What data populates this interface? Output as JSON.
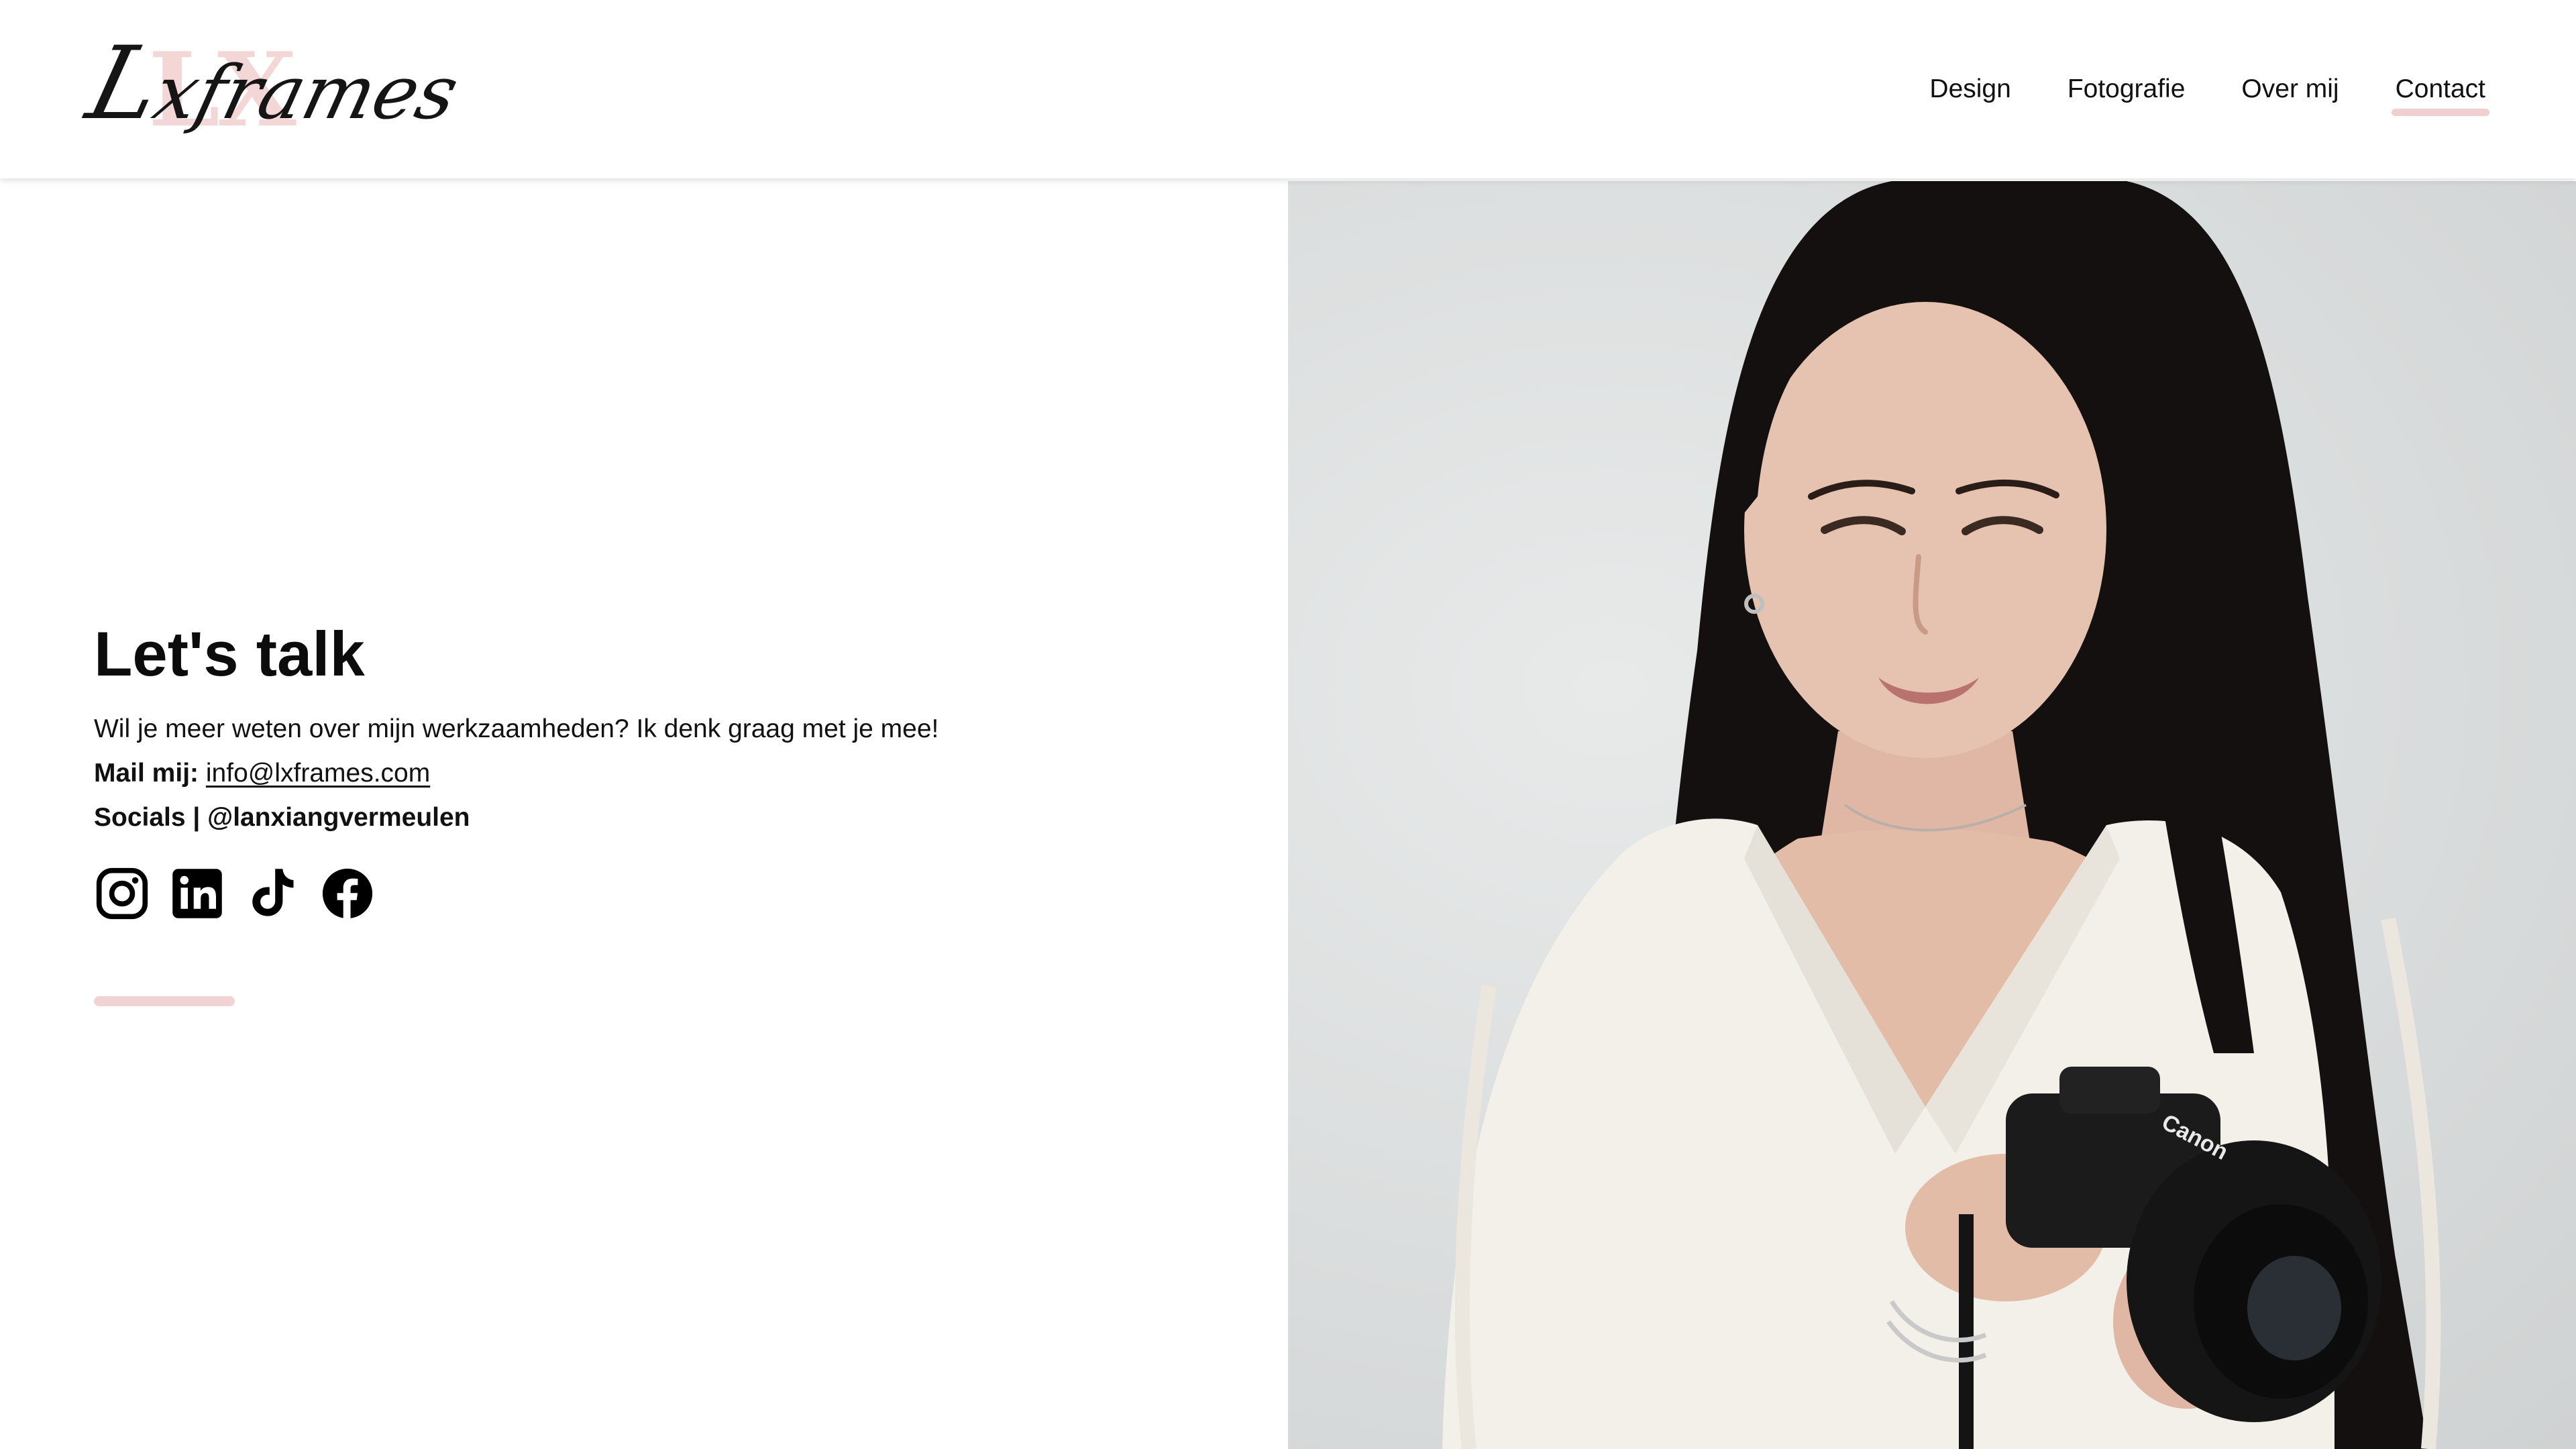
{
  "brand": {
    "monogram": "LX",
    "name": "Lxframes",
    "monogram_color": "#f3d6d6"
  },
  "nav": {
    "items": [
      {
        "label": "Design"
      },
      {
        "label": "Fotografie"
      },
      {
        "label": "Over mij"
      },
      {
        "label": "Contact",
        "active": true
      }
    ]
  },
  "contact": {
    "title": "Let's talk",
    "intro": "Wil je meer weten over mijn werkzaamheden? Ik denk graag met je mee!",
    "mail_label": "Mail mij:",
    "mail_value": "info@lxframes.com",
    "socials_label": "Socials | @lanxiangvermeulen",
    "social_icons": [
      "instagram-icon",
      "linkedin-icon",
      "tiktok-icon",
      "facebook-icon"
    ]
  },
  "photo": {
    "camera_brand": "Canon"
  },
  "colors": {
    "accent_pink": "#f1cfd0",
    "text": "#111111",
    "background": "#ffffff"
  }
}
